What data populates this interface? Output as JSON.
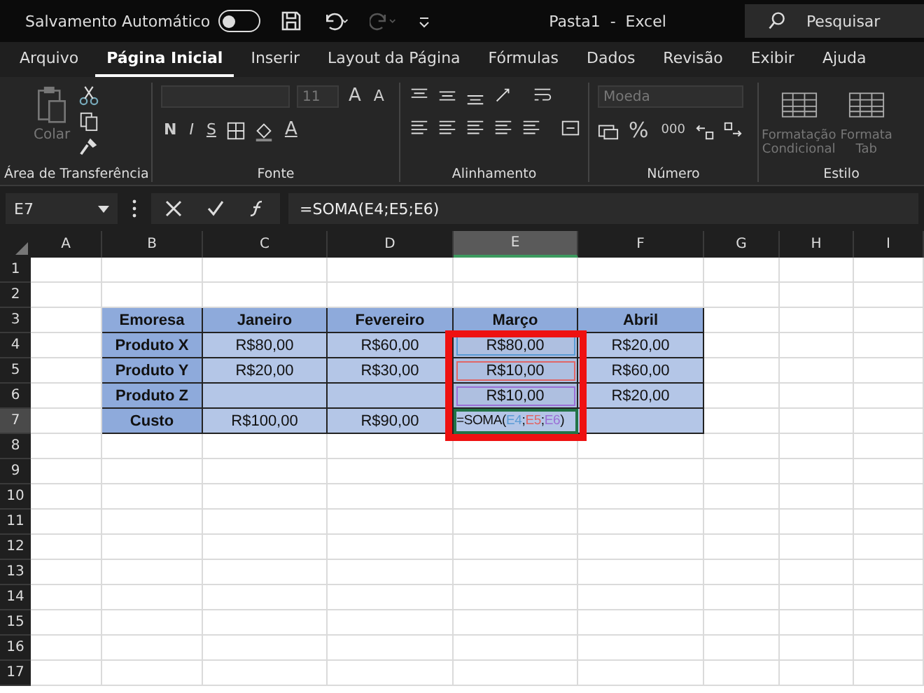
{
  "title_bar": {
    "autosave_label": "Salvamento Automático",
    "autosave_on": false,
    "title": "Pasta1  -  Excel",
    "search_placeholder": "Pesquisar"
  },
  "tabs": [
    {
      "label": "Arquivo",
      "selected": false
    },
    {
      "label": "Página Inicial",
      "selected": true
    },
    {
      "label": "Inserir",
      "selected": false
    },
    {
      "label": "Layout da Página",
      "selected": false
    },
    {
      "label": "Fórmulas",
      "selected": false
    },
    {
      "label": "Dados",
      "selected": false
    },
    {
      "label": "Revisão",
      "selected": false
    },
    {
      "label": "Exibir",
      "selected": false
    },
    {
      "label": "Ajuda",
      "selected": false
    }
  ],
  "ribbon": {
    "groups": [
      {
        "kind": "clipboard",
        "label": "Área de Transferência",
        "paste_label": "Colar"
      },
      {
        "kind": "font",
        "label": "Fonte",
        "size": "11",
        "grow": "A",
        "shrink": "A",
        "style_buttons": [
          "N",
          "I",
          "S"
        ],
        "color_letter": "A"
      },
      {
        "kind": "alignment",
        "label": "Alinhamento"
      },
      {
        "kind": "number",
        "label": "Número",
        "format": "Moeda",
        "percent": "%",
        "thousands": "000"
      },
      {
        "kind": "styles",
        "label": "Estilo",
        "buttons": [
          [
            "Formatação",
            "Condicional"
          ],
          [
            "Formata",
            "Tab"
          ]
        ]
      }
    ]
  },
  "formula_bar": {
    "name_box": "E7",
    "formula": "=SOMA(E4;E5;E6)"
  },
  "columns": [
    {
      "label": "A",
      "selected": false
    },
    {
      "label": "B",
      "selected": false
    },
    {
      "label": "C",
      "selected": false
    },
    {
      "label": "D",
      "selected": false
    },
    {
      "label": "E",
      "selected": true
    },
    {
      "label": "F",
      "selected": false
    },
    {
      "label": "G",
      "selected": false
    },
    {
      "label": "H",
      "selected": false
    },
    {
      "label": "I",
      "selected": false
    }
  ],
  "rows": [
    {
      "label": "1",
      "selected": false
    },
    {
      "label": "2",
      "selected": false
    },
    {
      "label": "3",
      "selected": false
    },
    {
      "label": "4",
      "selected": false
    },
    {
      "label": "5",
      "selected": false
    },
    {
      "label": "6",
      "selected": false
    },
    {
      "label": "7",
      "selected": true
    },
    {
      "label": "8",
      "selected": false
    },
    {
      "label": "9",
      "selected": false
    },
    {
      "label": "10",
      "selected": false
    },
    {
      "label": "11",
      "selected": false
    },
    {
      "label": "12",
      "selected": false
    },
    {
      "label": "13",
      "selected": false
    },
    {
      "label": "14",
      "selected": false
    },
    {
      "label": "15",
      "selected": false
    },
    {
      "label": "16",
      "selected": false
    },
    {
      "label": "17",
      "selected": false
    }
  ],
  "table": {
    "header": [
      "Emoresa",
      "Janeiro",
      "Fevereiro",
      "Março",
      "Abril"
    ],
    "rows": [
      {
        "label": "Produto X",
        "cells": [
          {
            "kind": "value",
            "text": "R$80,00"
          },
          {
            "kind": "value",
            "text": "R$60,00"
          },
          {
            "kind": "value",
            "text": "R$80,00",
            "color": "#5b9bd5"
          },
          {
            "kind": "value",
            "text": "R$20,00"
          }
        ]
      },
      {
        "label": "Produto Y",
        "cells": [
          {
            "kind": "value",
            "text": "R$20,00"
          },
          {
            "kind": "value",
            "text": "R$30,00"
          },
          {
            "kind": "value",
            "text": "R$10,00",
            "color": "#e06666"
          },
          {
            "kind": "value",
            "text": "R$60,00"
          }
        ]
      },
      {
        "label": "Produto Z",
        "cells": [
          {
            "kind": "empty"
          },
          {
            "kind": "empty"
          },
          {
            "kind": "value",
            "text": "R$10,00",
            "color": "#9b6fd6"
          },
          {
            "kind": "value",
            "text": "R$20,00"
          }
        ]
      },
      {
        "label": "Custo",
        "cells": [
          {
            "kind": "value",
            "text": "R$100,00"
          },
          {
            "kind": "value",
            "text": "R$90,00"
          },
          {
            "kind": "formula",
            "parts": [
              {
                "kind": "plain",
                "text": "=SOMA("
              },
              {
                "kind": "ref",
                "text": "E4",
                "color": "#5b9bd5"
              },
              {
                "kind": "plain",
                "text": ";"
              },
              {
                "kind": "ref",
                "text": "E5",
                "color": "#e06666"
              },
              {
                "kind": "plain",
                "text": ";"
              },
              {
                "kind": "ref",
                "text": "E6",
                "color": "#9b6fd6"
              },
              {
                "kind": "plain",
                "text": ")"
              }
            ]
          },
          {
            "kind": "empty"
          }
        ]
      }
    ]
  }
}
